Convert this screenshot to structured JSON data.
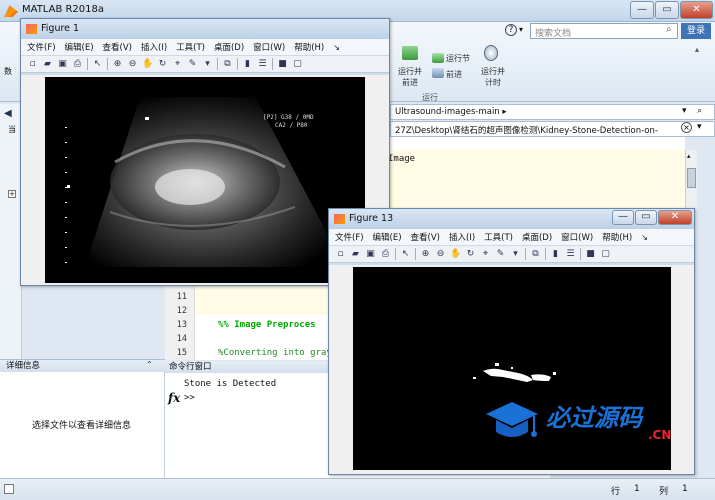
{
  "main": {
    "title": "MATLAB R2018a",
    "search_placeholder": "搜索文档",
    "login": "登录",
    "toolstrip": {
      "run_section": "运行节",
      "run_advance": "运行并\n前进",
      "advance": "前进",
      "run_time": "运行并\n计时",
      "section_label": "运行"
    },
    "address": "Ultrasound-images-main",
    "path": "27Z\\Desktop\\肾结石的超声图像检测\\Kidney-Stone-Detection-on-",
    "left_tab": "当",
    "details_header": "详细信息",
    "details_text": "选择文件以查看详细信息",
    "cmd_header": "命令行窗口",
    "cmd_output": "Stone is Detected",
    "cmd_prompt": ">>",
    "fx": "fx",
    "status_row": "行",
    "status_row_val": "1",
    "status_col": "列",
    "status_col_val": "1",
    "partial_left": "数"
  },
  "editor": {
    "lines": [
      {
        "n": "",
        "text": "Image",
        "color": "#0a0"
      },
      {
        "n": "11",
        "text": "",
        "color": "#000"
      },
      {
        "n": "12",
        "text": "",
        "color": "#000"
      },
      {
        "n": "13",
        "text": "%% Image Preproces",
        "color": "#0a0"
      },
      {
        "n": "14",
        "text": "",
        "color": "#000"
      },
      {
        "n": "15",
        "text": "%Converting into gray",
        "color": "#228b22"
      }
    ]
  },
  "fig1": {
    "title": "Figure 1",
    "menu": [
      "文件(F)",
      "编辑(E)",
      "查看(V)",
      "插入(I)",
      "工具(T)",
      "桌面(D)",
      "窗口(W)",
      "帮助(H)"
    ],
    "overlay_text": [
      "[P2] G38 / 0MD",
      "CA2 / P80"
    ]
  },
  "fig13": {
    "title": "Figure 13",
    "menu": [
      "文件(F)",
      "编辑(E)",
      "查看(V)",
      "插入(I)",
      "工具(T)",
      "桌面(D)",
      "窗口(W)",
      "帮助(H)"
    ]
  },
  "watermark": {
    "text": "必过源码",
    "sub": ".CN"
  }
}
